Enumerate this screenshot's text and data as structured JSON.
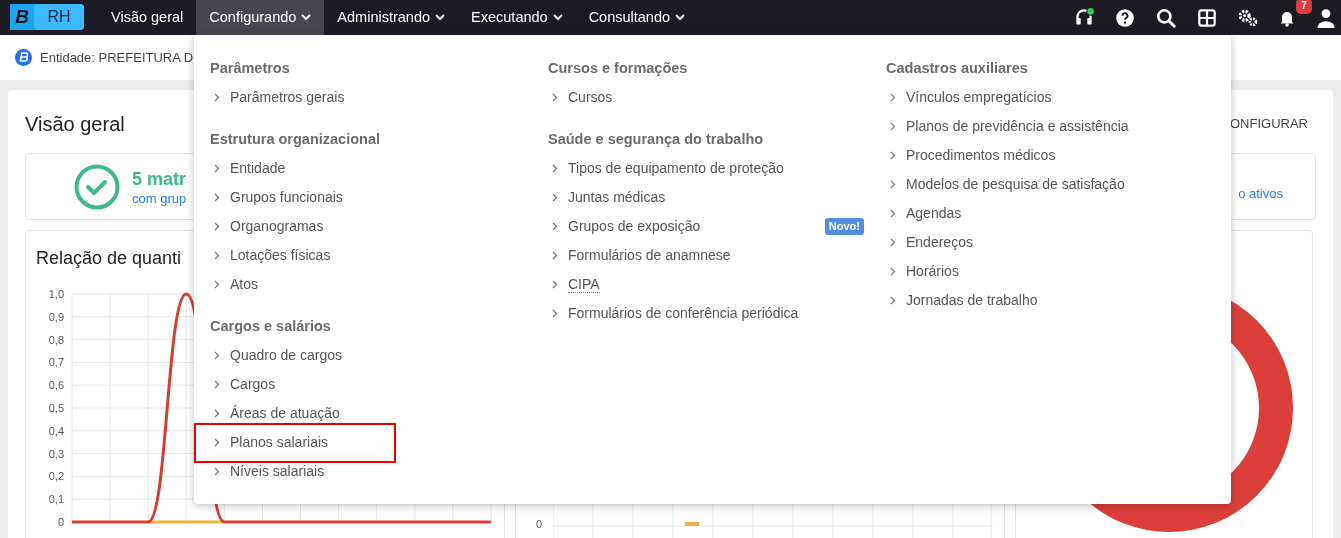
{
  "logo": {
    "letter": "B",
    "product": "RH"
  },
  "nav": [
    {
      "label": "Visão geral",
      "selected": false,
      "dropdown": false
    },
    {
      "label": "Configurando",
      "selected": true,
      "dropdown": true
    },
    {
      "label": "Administrando",
      "selected": false,
      "dropdown": true
    },
    {
      "label": "Executando",
      "selected": false,
      "dropdown": true
    },
    {
      "label": "Consultando",
      "selected": false,
      "dropdown": true
    }
  ],
  "toolbar": {
    "notifications_badge": "7",
    "support_online": true
  },
  "entity_bar": {
    "text": "Entidade: PREFEITURA D"
  },
  "overview": {
    "title": "Visão geral",
    "configure_link": "ONFIGURAR",
    "stat": {
      "value": "5 matr",
      "caption": "com grup",
      "right_link": "o ativos"
    },
    "chart_title": "Relação de quanti",
    "chart_data": {
      "type": "line",
      "grid": true,
      "yticks": [
        {
          "value": 0,
          "label": "0"
        },
        {
          "value": 0.1,
          "label": "0,1"
        },
        {
          "value": 0.2,
          "label": "0,2"
        },
        {
          "value": 0.3,
          "label": "0,3"
        },
        {
          "value": 0.4,
          "label": "0,4"
        },
        {
          "value": 0.5,
          "label": "0,5"
        },
        {
          "value": 0.6,
          "label": "0,6"
        },
        {
          "value": 0.7,
          "label": "0,7"
        },
        {
          "value": 0.8,
          "label": "0,8"
        },
        {
          "value": 0.9,
          "label": "0,9"
        },
        {
          "value": 1,
          "label": "1,0"
        }
      ],
      "ylim": [
        0,
        1
      ],
      "series": [
        {
          "color": "#e8b53a",
          "values": [
            null,
            null,
            0,
            0,
            0,
            null,
            null,
            null,
            null,
            null,
            null,
            null
          ]
        },
        {
          "color": "#d93c37",
          "values": [
            0,
            0,
            0,
            1,
            0,
            0,
            0,
            0,
            0,
            0,
            0,
            0
          ]
        }
      ]
    },
    "chart2_tick": "0"
  },
  "menu": {
    "columns": [
      {
        "sections": [
          {
            "heading": "Parâmetros",
            "items": [
              {
                "label": "Parâmetros gerais",
                "highlighted": false
              }
            ]
          },
          {
            "heading": "Estrutura organizacional",
            "items": [
              {
                "label": "Entidade",
                "highlighted": false
              },
              {
                "label": "Grupos funcionais",
                "highlighted": false
              },
              {
                "label": "Organogramas",
                "highlighted": false
              },
              {
                "label": "Lotações físicas",
                "highlighted": false
              },
              {
                "label": "Atos",
                "highlighted": false
              }
            ]
          },
          {
            "heading": "Cargos e salários",
            "items": [
              {
                "label": "Quadro de cargos",
                "highlighted": false
              },
              {
                "label": "Cargos",
                "highlighted": false
              },
              {
                "label": "Áreas de atuação",
                "highlighted": false
              },
              {
                "label": "Planos salariais",
                "highlighted": true
              },
              {
                "label": "Níveis salariais",
                "highlighted": false
              }
            ]
          }
        ]
      },
      {
        "sections": [
          {
            "heading": "Cursos e formações",
            "items": [
              {
                "label": "Cursos",
                "highlighted": false
              }
            ]
          },
          {
            "heading": "Saúde e segurança do trabalho",
            "items": [
              {
                "label": "Tipos de equipamento de proteção",
                "highlighted": false
              },
              {
                "label": "Juntas médicas",
                "highlighted": false
              },
              {
                "label": "Grupos de exposição",
                "highlighted": false,
                "badge": "Novo!"
              },
              {
                "label": "Formulários de anamnese",
                "highlighted": false
              },
              {
                "label": "CIPA",
                "highlighted": false,
                "dotted": true
              },
              {
                "label": "Formulários de conferência periódica",
                "highlighted": false
              }
            ]
          }
        ]
      },
      {
        "sections": [
          {
            "heading": "Cadastros auxiliares",
            "items": [
              {
                "label": "Vínculos empregatícios",
                "highlighted": false
              },
              {
                "label": "Planos de previdência e assistência",
                "highlighted": false
              },
              {
                "label": "Procedimentos médicos",
                "highlighted": false
              },
              {
                "label": "Modelos de pesquisa de satisfação",
                "highlighted": false
              },
              {
                "label": "Agendas",
                "highlighted": false
              },
              {
                "label": "Endereços",
                "highlighted": false
              },
              {
                "label": "Horários",
                "highlighted": false
              },
              {
                "label": "Jornadas de trabalho",
                "highlighted": false
              }
            ]
          }
        ]
      }
    ]
  }
}
